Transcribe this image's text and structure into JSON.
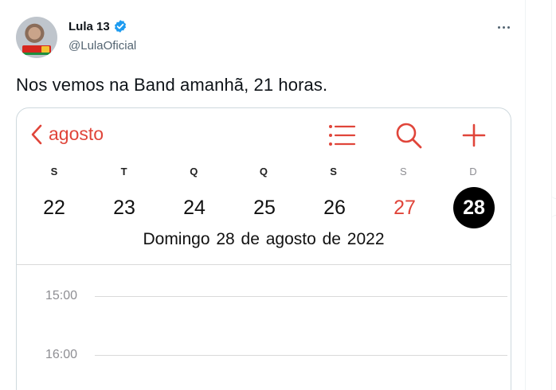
{
  "tweet": {
    "display_name": "Lula 13",
    "handle": "@LulaOficial",
    "text": "Nos vemos na Band amanhã, 21 horas."
  },
  "avatar_badge": "LULA 13",
  "calendar": {
    "month_label": "agosto",
    "weekdays": [
      "S",
      "T",
      "Q",
      "Q",
      "S",
      "S",
      "D"
    ],
    "dates": [
      "22",
      "23",
      "24",
      "25",
      "26",
      "27",
      "28"
    ],
    "today_index": 6,
    "full_date": "Domingo  28 de agosto de 2022",
    "times": [
      "15:00",
      "16:00"
    ]
  },
  "colors": {
    "accent": "#e0453a",
    "verified": "#1d9bf0",
    "today_bg": "#000000"
  },
  "icons": [
    "verified-badge-icon",
    "more-options-icon",
    "back-chevron-icon",
    "list-icon",
    "search-icon",
    "add-icon"
  ]
}
